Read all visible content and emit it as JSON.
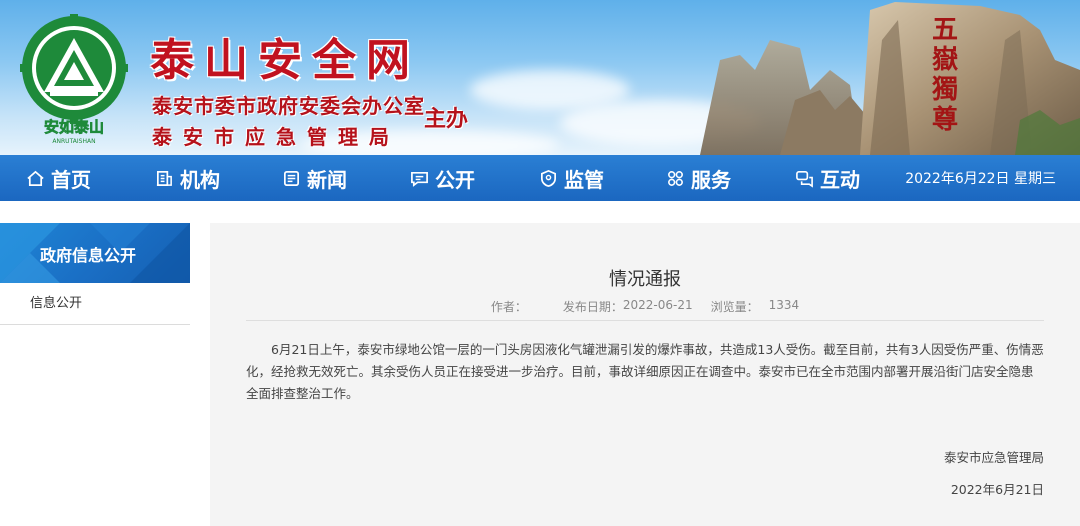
{
  "header": {
    "site_title": "泰山安全网",
    "org_line1": "泰安市委市政府安委会办公室",
    "org_line2": "泰安市应急管理局",
    "sponsor": "主办",
    "logo_text": "安如泰山",
    "logo_subtext": "ANRUTAISHAN",
    "stone_inscription": "五嶽獨尊"
  },
  "nav": {
    "items": [
      {
        "label": "首页",
        "icon": "home-icon"
      },
      {
        "label": "机构",
        "icon": "building-icon"
      },
      {
        "label": "新闻",
        "icon": "news-icon"
      },
      {
        "label": "公开",
        "icon": "message-icon"
      },
      {
        "label": "监管",
        "icon": "shield-icon"
      },
      {
        "label": "服务",
        "icon": "grid-icon"
      },
      {
        "label": "互动",
        "icon": "chat-icon"
      }
    ],
    "date": "2022年6月22日 星期三"
  },
  "sidebar": {
    "heading": "政府信息公开",
    "items": [
      {
        "label": "信息公开"
      }
    ]
  },
  "article": {
    "title": "情况通报",
    "author_label": "作者：",
    "author": "",
    "publish_label": "发布日期：",
    "publish_date": "2022-06-21",
    "views_label": "浏览量：",
    "views": "1334",
    "body": "6月21日上午，泰安市绿地公馆一层的一门头房因液化气罐泄漏引发的爆炸事故，共造成13人受伤。截至目前，共有3人因受伤严重、伤情恶化，经抢救无效死亡。其余受伤人员正在接受进一步治疗。目前，事故详细原因正在调查中。泰安市已在全市范围内部署开展沿街门店安全隐患全面排查整治工作。",
    "sign_org": "泰安市应急管理局",
    "sign_date": "2022年6月21日"
  },
  "colors": {
    "nav_blue": "#1b67c0",
    "title_red": "#c1121f",
    "logo_green": "#1e8a3a"
  }
}
